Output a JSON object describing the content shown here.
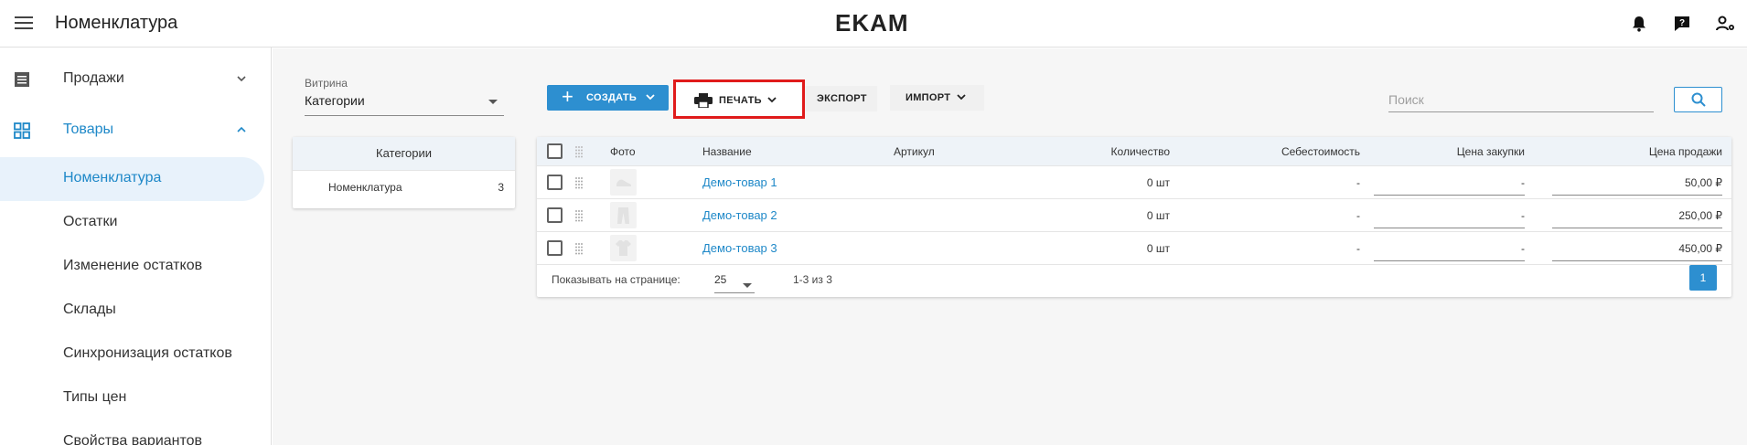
{
  "header": {
    "title": "Номенклатура",
    "logo": "EKAM",
    "icons": [
      "menu-icon",
      "bell-icon",
      "help-chat-icon",
      "user-settings-icon"
    ]
  },
  "sidebar": {
    "items": [
      {
        "label": "Продажи",
        "icon": "list-icon",
        "expanded": false
      },
      {
        "label": "Товары",
        "icon": "grid-icon",
        "expanded": true,
        "accent": "#1e88c8"
      }
    ],
    "subitems": [
      {
        "label": "Номенклатура",
        "active": true
      },
      {
        "label": "Остатки"
      },
      {
        "label": "Изменение остатков"
      },
      {
        "label": "Склады"
      },
      {
        "label": "Синхронизация остатков"
      },
      {
        "label": "Типы цен"
      },
      {
        "label": "Свойства вариантов"
      }
    ]
  },
  "filter": {
    "label": "Витрина",
    "value": "Категории"
  },
  "categories": {
    "header": "Категории",
    "rows": [
      {
        "name": "Номенклатура",
        "count": "3"
      }
    ]
  },
  "toolbar": {
    "create_label": "СОЗДАТЬ",
    "print_label": "ПЕЧАТЬ",
    "export_label": "ЭКСПОРТ",
    "import_label": "ИМПОРТ",
    "search_placeholder": "Поиск",
    "accent_color": "#2d8fd0",
    "highlight_color": "#e01b1b"
  },
  "table": {
    "columns": [
      "Фото",
      "Название",
      "Артикул",
      "Количество",
      "Себестоимость",
      "Цена закупки",
      "Цена продажи"
    ],
    "rows": [
      {
        "name": "Демо-товар 1",
        "article": "",
        "qty": "0 шт",
        "cost": "-",
        "purchase": "-",
        "price": "50,00 ₽",
        "photo_icon": "shoe-icon"
      },
      {
        "name": "Демо-товар 2",
        "article": "",
        "qty": "0 шт",
        "cost": "-",
        "purchase": "-",
        "price": "250,00 ₽",
        "photo_icon": "trousers-icon"
      },
      {
        "name": "Демо-товар 3",
        "article": "",
        "qty": "0 шт",
        "cost": "-",
        "purchase": "-",
        "price": "450,00 ₽",
        "photo_icon": "tshirt-icon"
      }
    ],
    "footer": {
      "per_page_label": "Показывать на странице:",
      "per_page": "25",
      "range": "1-3 из 3",
      "page": "1"
    }
  }
}
